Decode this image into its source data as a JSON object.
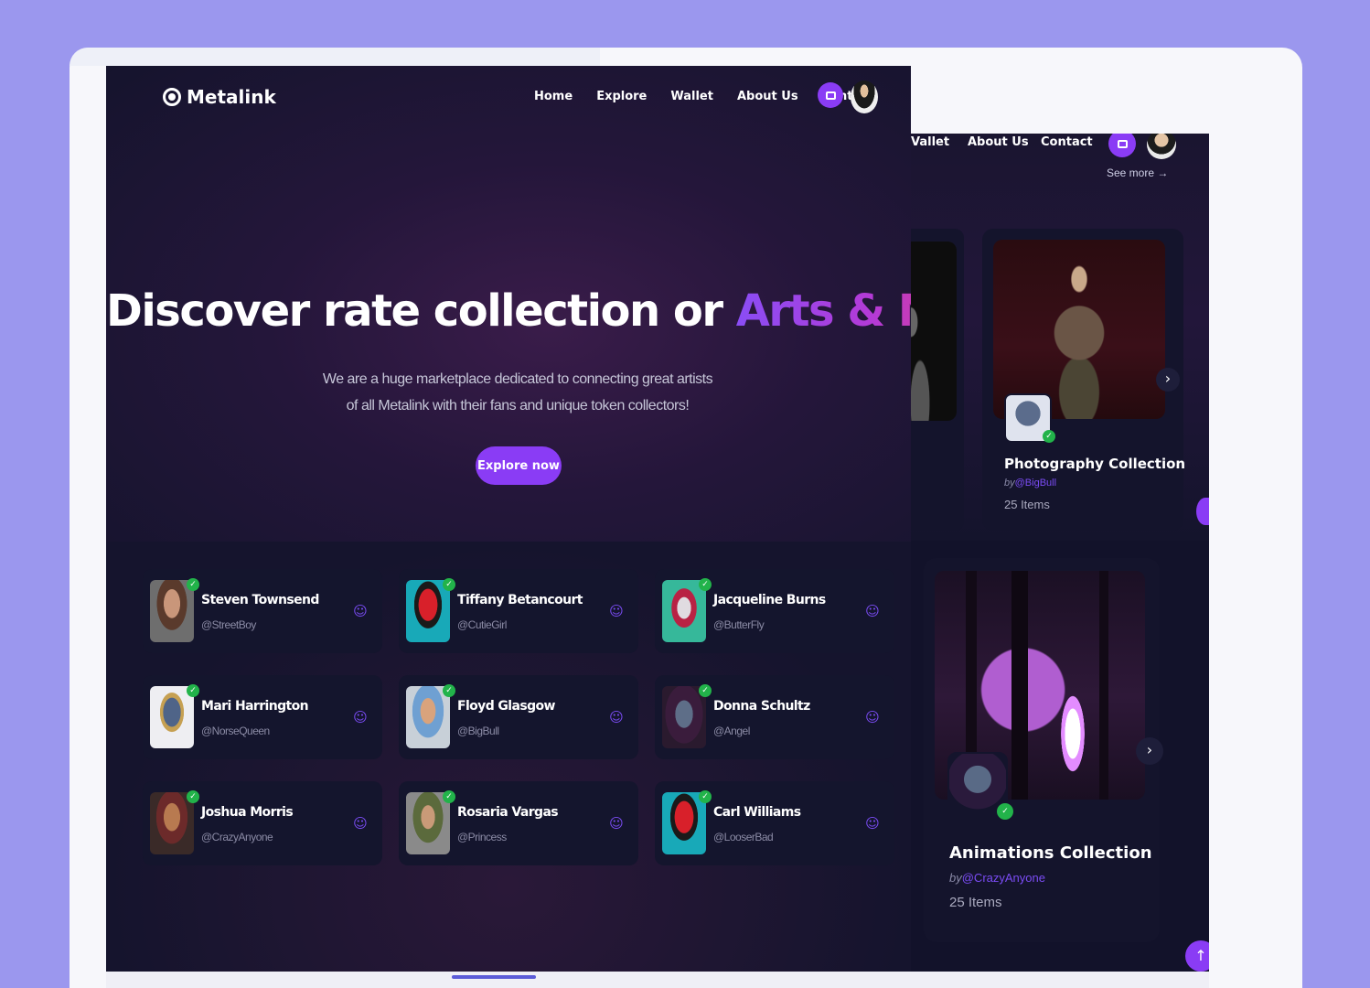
{
  "front": {
    "brand": "Metalink",
    "nav": [
      "Home",
      "Explore",
      "Wallet",
      "About Us",
      "Contact"
    ],
    "headline_white": "Discover rate collection or ",
    "headline_accent": "Arts & NFTs",
    "subtext_line1": "We are a huge marketplace dedicated to connecting great artists",
    "subtext_line2": "of all Metalink with their fans and unique token collectors!",
    "cta": "Explore now",
    "creators": [
      {
        "name": "Steven Townsend",
        "handle": "@StreetBoy"
      },
      {
        "name": "Tiffany Betancourt",
        "handle": "@CutieGirl"
      },
      {
        "name": "Jacqueline Burns",
        "handle": "@ButterFly"
      },
      {
        "name": "Mari Harrington",
        "handle": "@NorseQueen"
      },
      {
        "name": "Floyd Glasgow",
        "handle": "@BigBull"
      },
      {
        "name": "Donna Schultz",
        "handle": "@Angel"
      },
      {
        "name": "Joshua Morris",
        "handle": "@CrazyAnyone"
      },
      {
        "name": "Rosaria Vargas",
        "handle": "@Princess"
      },
      {
        "name": "Carl Williams",
        "handle": "@LooserBad"
      }
    ]
  },
  "back": {
    "nav": [
      "Vallet",
      "About Us",
      "Contact"
    ],
    "see_more": "See more →",
    "collections": [
      {
        "title": "Photography Collection",
        "by_prefix": "by",
        "by_handle": "@BigBull",
        "items": "25 Items"
      },
      {
        "title": "Animations Collection",
        "by_prefix": "by",
        "by_handle": "@CrazyAnyone",
        "items": "25 Items"
      }
    ]
  },
  "icons": {
    "wallet": "wallet-icon",
    "follow": "user-follow-icon",
    "next": "chevron-right-icon",
    "up": "arrow-up-icon",
    "verified": "check-badge-icon"
  },
  "colors": {
    "accent": "#8a3cf5",
    "background": "#12122a",
    "outer": "#9b97ee",
    "verified": "#22b34a"
  }
}
